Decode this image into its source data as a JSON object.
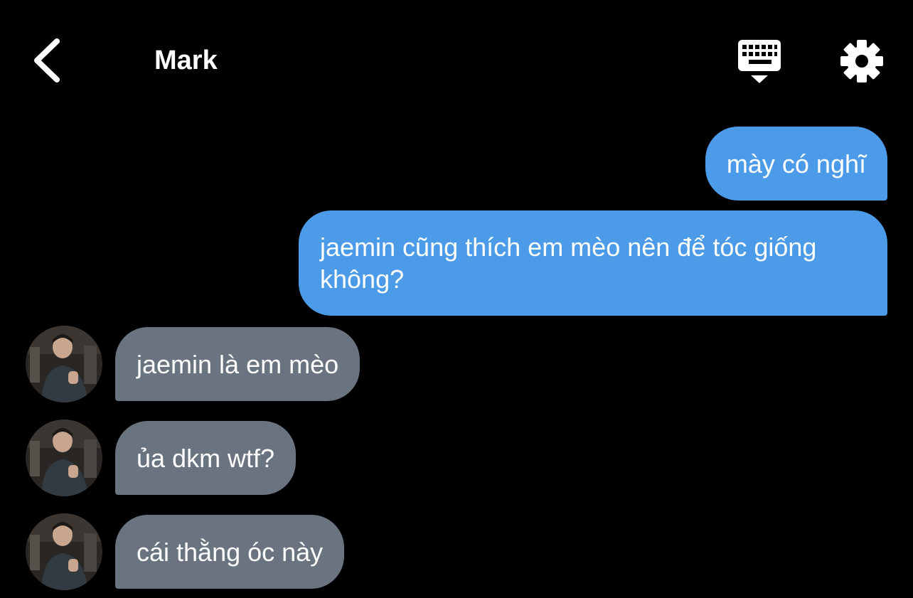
{
  "header": {
    "title": "Mark",
    "back_icon": "chevron-left-icon",
    "keyboard_icon": "keyboard-hide-icon",
    "settings_icon": "gear-icon"
  },
  "messages": [
    {
      "from": "me",
      "text": "mày có nghĩ"
    },
    {
      "from": "me",
      "text": "jaemin cũng thích em mèo nên để tóc giống không?"
    },
    {
      "from": "Mark",
      "text": "jaemin là em mèo"
    },
    {
      "from": "Mark",
      "text": "ủa dkm wtf?"
    },
    {
      "from": "Mark",
      "text": "cái thằng óc này"
    }
  ],
  "colors": {
    "background": "#000000",
    "sent_bubble": "#4c9be8",
    "received_bubble": "#6a7480",
    "text": "#ffffff"
  }
}
